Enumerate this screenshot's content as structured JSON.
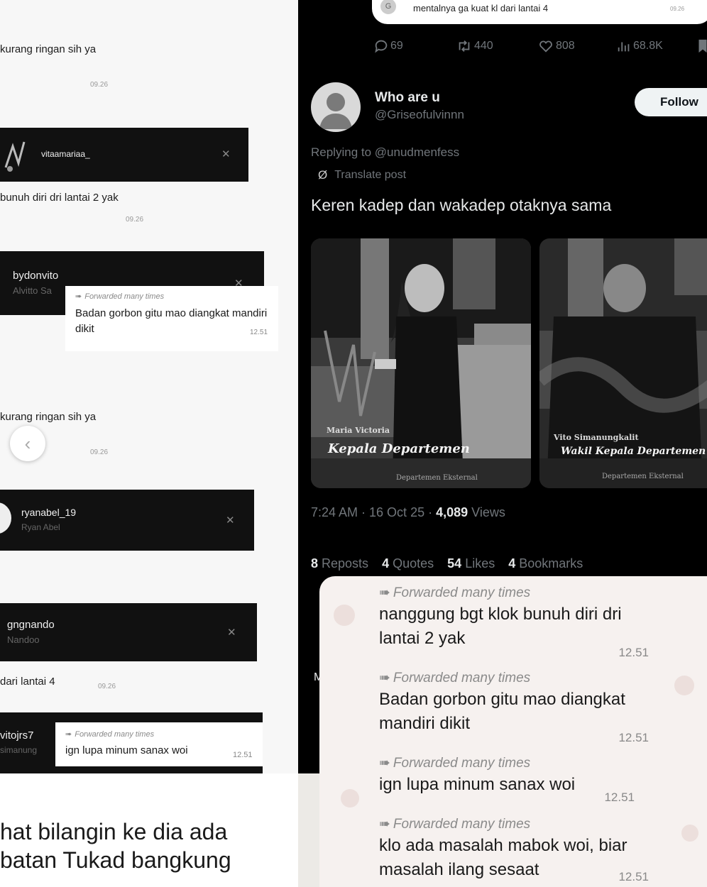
{
  "left": {
    "line1": "kurang ringan sih ya",
    "time1": "09.26",
    "dm1": {
      "name": "vitaamariaa_"
    },
    "line2": "bunuh diri dri lantai 2 yak",
    "time2": "09.26",
    "dm2": {
      "name": "bydonvito",
      "handle": "Alvitto Sa"
    },
    "fwd1": {
      "label": "Forwarded many times",
      "text": "Badan gorbon gitu mao diangkat mandiri dikit",
      "time": "12.51"
    },
    "line3": "kurang ringan sih ya",
    "time3": "09.26",
    "dm3": {
      "name": "ryanabel_19",
      "handle": "Ryan Abel"
    },
    "dm4": {
      "name": "gngnando",
      "handle": "Nandoo"
    },
    "line4": "dari lantai 4",
    "time4": "09.26",
    "dm5": {
      "name": "vitojrs7",
      "handle": "simanung"
    },
    "fwd2": {
      "label": "Forwarded many times",
      "text": "ign lupa minum sanax woi",
      "time": "12.51"
    }
  },
  "bottom_left": {
    "line1": "hat bilangin ke dia ada",
    "line2": "batan Tukad bangkung"
  },
  "post": {
    "quoted_text": "mentalnya ga kuat kl dari lantai 4",
    "quoted_time": "09.26",
    "actions": {
      "replies": "69",
      "reposts": "440",
      "likes": "808",
      "views": "68.8K"
    },
    "display_name": "Who are u",
    "handle": "@Griseofulvinnn",
    "follow_label": "Follow",
    "replying_to": "Replying to @unudmenfess",
    "translate_label": "Translate post",
    "text": "Keren kadep dan wakadep otaknya sama",
    "photos": [
      {
        "name_caption": "Maria Victoria",
        "title_caption": "Kepala Departemen",
        "dept_caption": "Departemen Eksternal"
      },
      {
        "name_caption": "Vito Simanungkalit",
        "title_caption": "Wakil Kepala Departemen",
        "dept_caption": "Departemen Eksternal"
      }
    ],
    "time": "7:24 AM · 16 Oct 25 · ",
    "views_count": "4,089",
    "views_label": " Views",
    "stats": {
      "reposts_n": "8",
      "reposts_l": "Reposts",
      "quotes_n": "4",
      "quotes_l": "Quotes",
      "likes_n": "54",
      "likes_l": "Likes",
      "bookmarks_n": "4",
      "bookmarks_l": "Bookmarks"
    },
    "edge_letter": "M"
  },
  "forwarded_panel": {
    "label": "Forwarded many times",
    "messages": [
      {
        "text": "nanggung bgt klok bunuh diri dri lantai 2 yak",
        "time": "12.51"
      },
      {
        "text": "Badan gorbon gitu mao diangkat mandiri dikit",
        "time": "12.51"
      },
      {
        "text": "ign lupa minum sanax woi",
        "time": "12.51"
      },
      {
        "text": "klo ada masalah mabok woi, biar masalah ilang sesaat",
        "time": "12.51"
      }
    ]
  },
  "colors": {
    "x_background": "#000000",
    "x_text": "#e7e9ea",
    "x_muted": "#71767b",
    "chat_bg": "#f6f1ef"
  }
}
